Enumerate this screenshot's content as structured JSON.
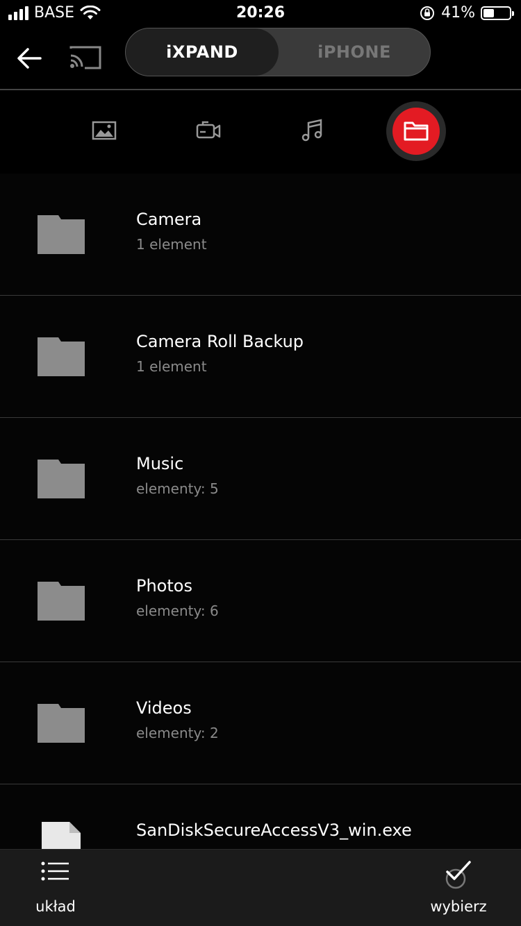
{
  "status_bar": {
    "carrier": "BASE",
    "time": "20:26",
    "battery_percent": "41%",
    "battery_level": 0.41
  },
  "nav": {
    "back_icon": "arrow-left-icon",
    "cast_icon": "cast-icon",
    "segments": [
      {
        "label": "iXPAND",
        "active": true
      },
      {
        "label": "iPHONE",
        "active": false
      }
    ]
  },
  "categories": [
    {
      "name": "photos",
      "icon": "image-icon",
      "active": false
    },
    {
      "name": "videos",
      "icon": "video-camera-icon",
      "active": false
    },
    {
      "name": "music",
      "icon": "music-note-icon",
      "active": false
    },
    {
      "name": "folders",
      "icon": "folder-icon",
      "active": true
    }
  ],
  "accent_color": "#e31b23",
  "files": [
    {
      "name": "Camera",
      "meta": "1 element",
      "type": "folder"
    },
    {
      "name": "Camera Roll Backup",
      "meta": "1 element",
      "type": "folder"
    },
    {
      "name": "Music",
      "meta": "elementy: 5",
      "type": "folder"
    },
    {
      "name": "Photos",
      "meta": "elementy: 6",
      "type": "folder"
    },
    {
      "name": "Videos",
      "meta": "elementy: 2",
      "type": "folder"
    },
    {
      "name": "SanDiskSecureAccessV3_win.exe",
      "meta": "",
      "type": "file"
    }
  ],
  "bottom_bar": {
    "layout_label": "układ",
    "select_label": "wybierz"
  }
}
